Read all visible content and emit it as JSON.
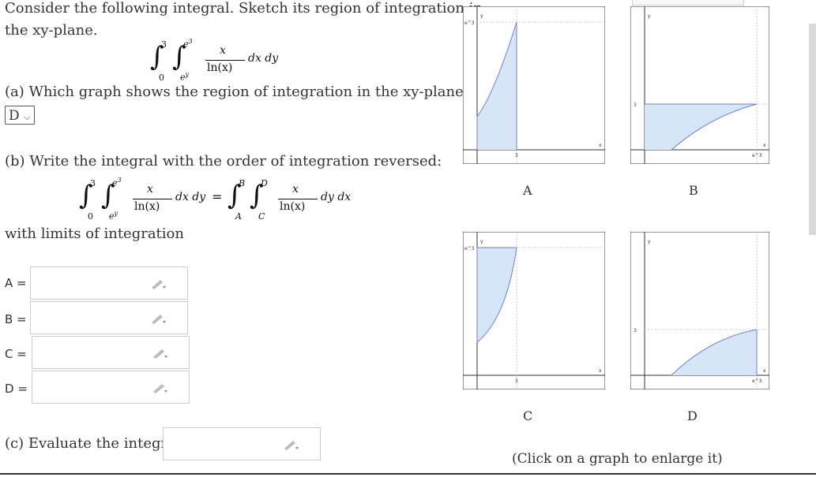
{
  "question": {
    "intro_line1": "Consider the following integral. Sketch its region of integration in",
    "intro_line2": "the xy-plane.",
    "part_a": "(a) Which graph shows the region of integration in the xy-plane?",
    "part_a_selected": "D",
    "part_b": "(b) Write the integral with the order of integration reversed:",
    "with_limits": "with limits of integration",
    "part_c": "(c) Evaluate the integral."
  },
  "integral": {
    "outer_lower": "0",
    "outer_upper": "3",
    "inner_lower": "e",
    "inner_lower_sup": "y",
    "inner_upper": "e",
    "inner_upper_sup": "3",
    "numerator": "x",
    "denominator": "ln(x)",
    "diff_original": "dx dy",
    "diff_reversed": "dy dx",
    "rev_outer_lower": "A",
    "rev_outer_upper": "B",
    "rev_inner_lower": "C",
    "rev_inner_upper": "D",
    "equals": "="
  },
  "answers": [
    {
      "label": "A =",
      "value": ""
    },
    {
      "label": "B =",
      "value": ""
    },
    {
      "label": "C =",
      "value": ""
    },
    {
      "label": "D =",
      "value": ""
    }
  ],
  "part_c_answer": "",
  "graphs": [
    {
      "label": "A",
      "ylabel": "y",
      "xlabel": "x",
      "ytick": "e^3",
      "xtick": "3"
    },
    {
      "label": "B",
      "ylabel": "y",
      "xlabel": "x",
      "ytick": "3",
      "xtick": "e^3"
    },
    {
      "label": "C",
      "ylabel": "y",
      "xlabel": "x",
      "ytick": "e^3",
      "xtick": "3"
    },
    {
      "label": "D",
      "ylabel": "y",
      "xlabel": "x",
      "ytick": "3",
      "xtick": "e^3"
    }
  ],
  "click_hint": "(Click on a graph to enlarge it)",
  "colors": {
    "region_fill": "#d6e6f7",
    "region_stroke": "#6b7fe6",
    "axis": "#333"
  }
}
